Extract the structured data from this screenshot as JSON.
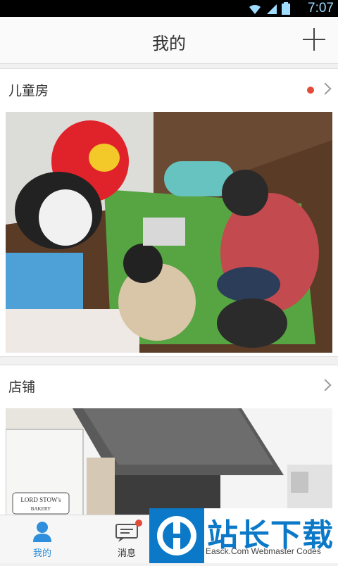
{
  "status_bar": {
    "time": "7:07",
    "icons": [
      "wifi-icon",
      "signal-icon",
      "battery-icon"
    ]
  },
  "header": {
    "title": "我的",
    "add_icon": "plus-icon"
  },
  "sections": [
    {
      "label": "儿童房",
      "has_new_dot": true,
      "photo": "children-room-photo"
    },
    {
      "label": "店铺",
      "has_new_dot": false,
      "photo": "storefront-photo"
    }
  ],
  "tabbar": {
    "tabs": [
      {
        "label": "我的",
        "icon": "person-icon",
        "active": true
      },
      {
        "label": "消息",
        "icon": "message-icon",
        "active": false,
        "badge": true
      }
    ]
  },
  "watermark": {
    "title": "站长下载",
    "subtitle": "Easck.Com Webmaster Codes"
  },
  "storefront": {
    "sign_text": "LORD STOW's",
    "sign_sub": "BAKERY"
  },
  "colors": {
    "accent": "#2f8fdc",
    "badge": "#e24a3a",
    "watermark_blue": "#0b79c7"
  }
}
